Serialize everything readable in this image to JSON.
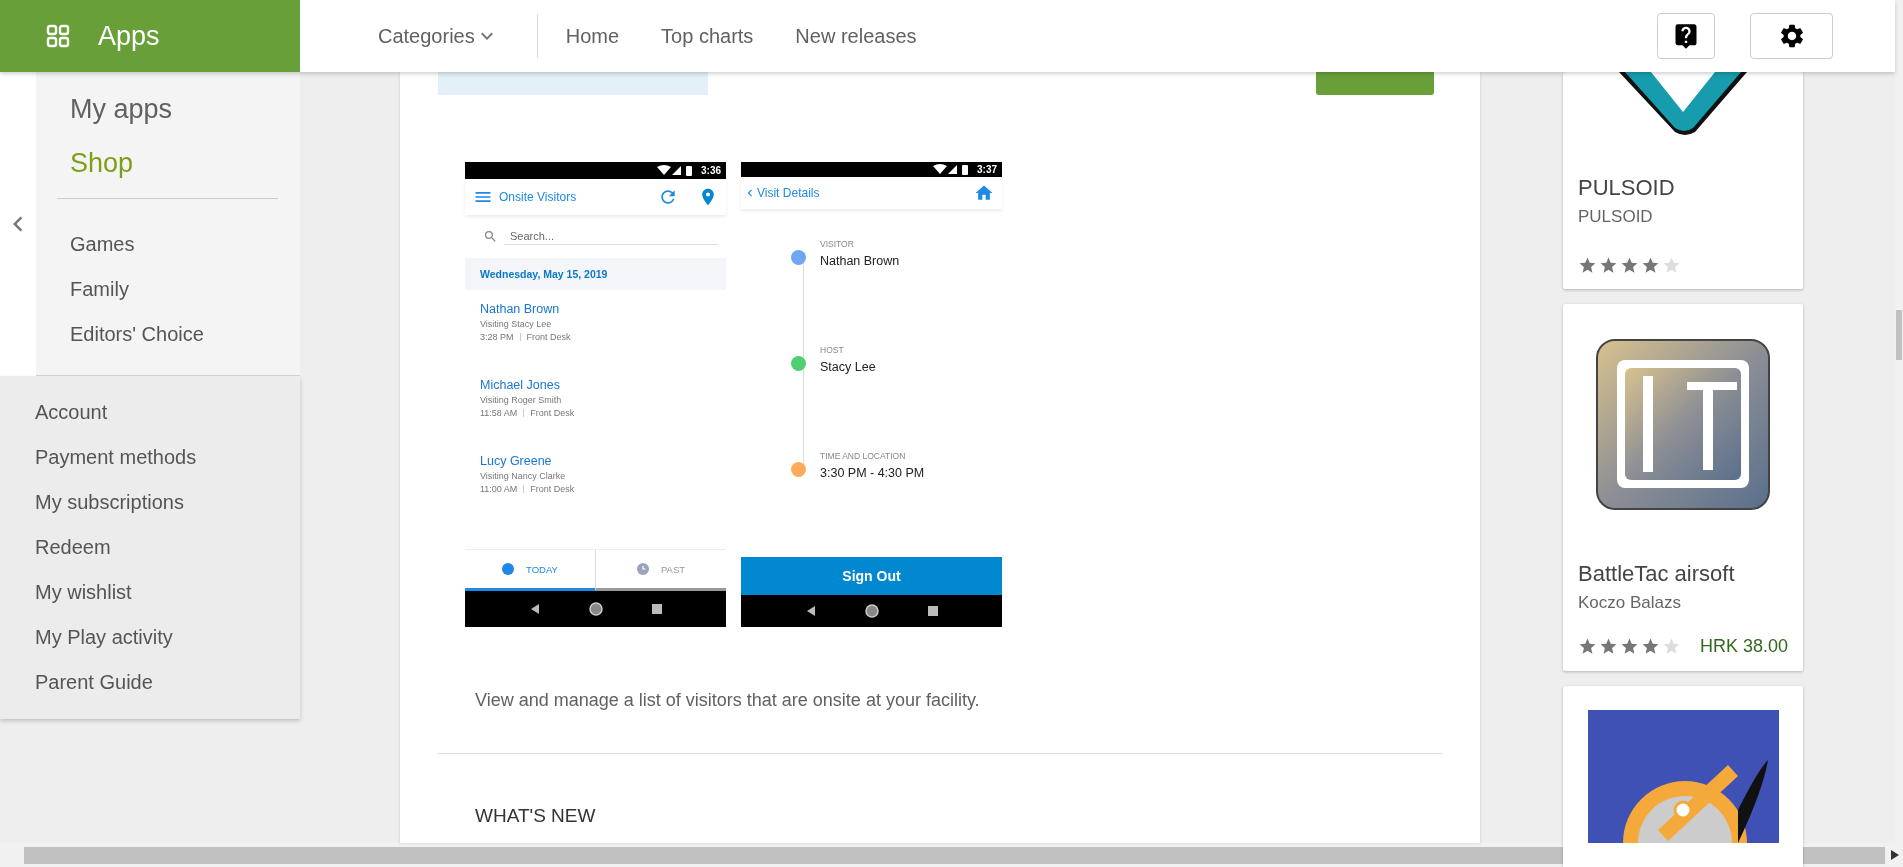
{
  "header": {
    "section": "Apps",
    "nav": [
      {
        "label": "Categories",
        "kind": "dropdown"
      },
      {
        "label": "Home",
        "kind": "link"
      },
      {
        "label": "Top charts",
        "kind": "link"
      },
      {
        "label": "New releases",
        "kind": "link"
      }
    ]
  },
  "sidebar": {
    "main": [
      {
        "label": "My apps",
        "selected": false
      },
      {
        "label": "Shop",
        "selected": true
      }
    ],
    "categories": [
      "Games",
      "Family",
      "Editors' Choice"
    ],
    "account": [
      "Account",
      "Payment methods",
      "My subscriptions",
      "Redeem",
      "My wishlist",
      "My Play activity",
      "Parent Guide"
    ]
  },
  "screenshots": [
    {
      "kind": "visitor_list",
      "time": "3:36",
      "title": "Onsite Visitors",
      "search": {
        "placeholder": "Search..."
      },
      "date": "Wednesday, May 15, 2019",
      "visits": [
        {
          "name": "Nathan Brown",
          "host": "Visiting Stacy Lee",
          "time": "3:28 PM",
          "place": "Front Desk"
        },
        {
          "name": "Michael Jones",
          "host": "Visiting Roger Smith",
          "time": "11:58 AM",
          "place": "Front Desk"
        },
        {
          "name": "Lucy Greene",
          "host": "Visiting Nancy Clarke",
          "time": "11:00 AM",
          "place": "Front Desk"
        }
      ],
      "tabs": [
        {
          "label": "TODAY",
          "selected": true
        },
        {
          "label": "PAST",
          "selected": false
        }
      ]
    },
    {
      "kind": "visit_details",
      "time": "3:37",
      "title": "Visit Details",
      "fields": [
        {
          "label": "VISITOR",
          "value": "Nathan Brown",
          "color": "#6ea6f0"
        },
        {
          "label": "HOST",
          "value": "Stacy Lee",
          "color": "#4fcf6f"
        },
        {
          "label": "TIME AND LOCATION",
          "value": "3:30 PM - 4:30 PM",
          "color": "#ffab5c"
        }
      ],
      "button": "Sign Out"
    }
  ],
  "description": "View and manage a list of visitors that are onsite at your facility.",
  "whats_new": {
    "title": "WHAT'S NEW"
  },
  "similar_apps": [
    {
      "title": "PULSOID",
      "developer": "PULSOID",
      "stars": 4
    },
    {
      "title": "BattleTac airsoft",
      "developer": "Koczo Balazs",
      "stars": 4,
      "price": "HRK 38.00"
    }
  ],
  "more_apps_card": true
}
